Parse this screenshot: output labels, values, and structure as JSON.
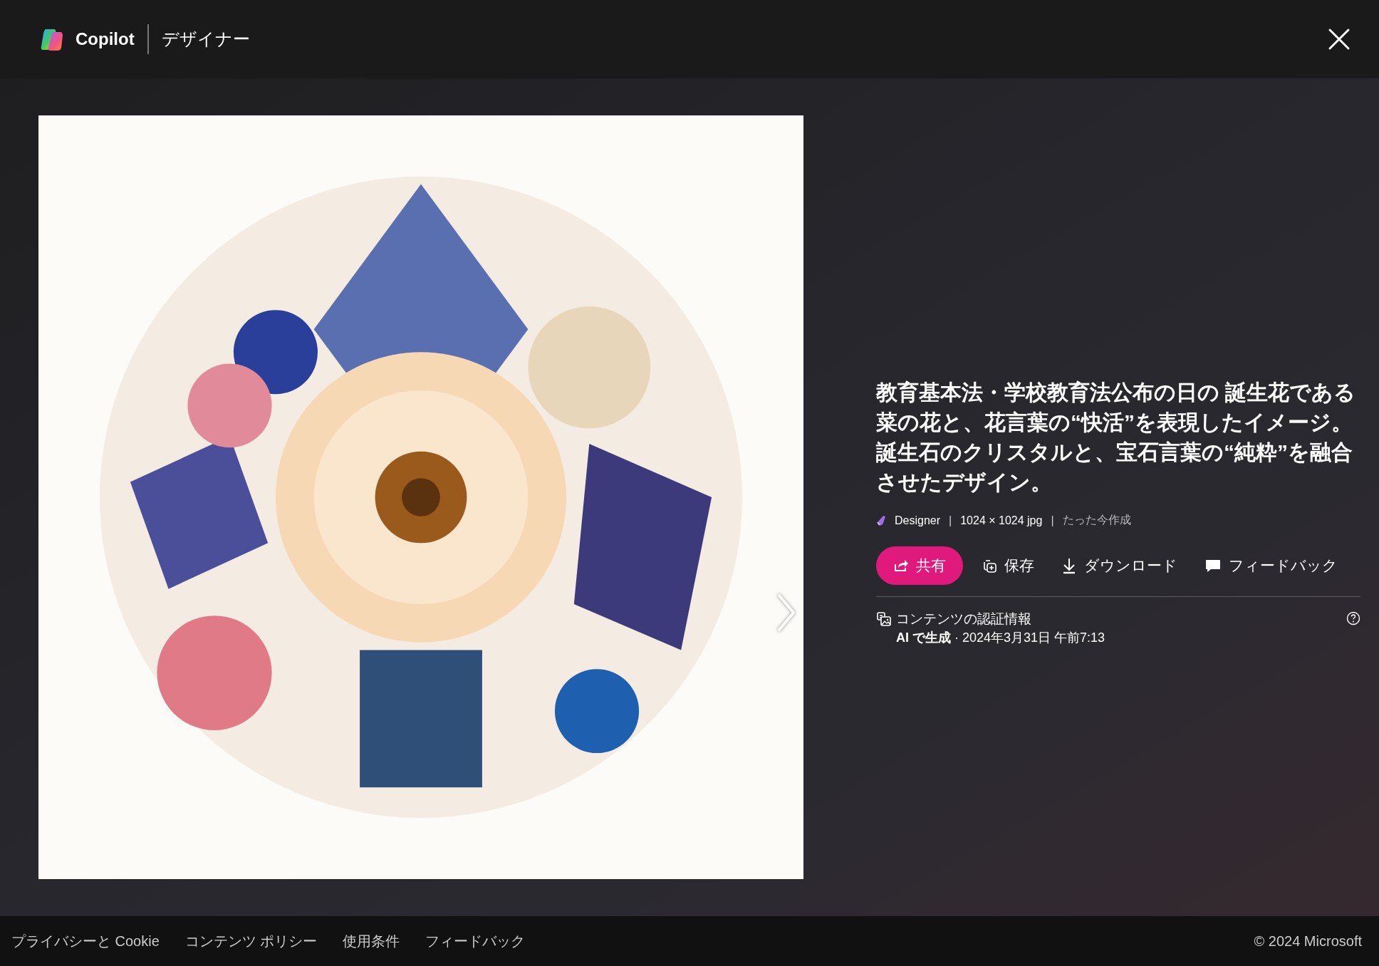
{
  "header": {
    "brand": "Copilot",
    "product": "デザイナー"
  },
  "details": {
    "title": "教育基本法・学校教育法公布の日の 誕生花である菜の花と、花言葉の“快活”を表現したイメージ。誕生石のクリスタルと、宝石言葉の“純粋”を融合させたデザイン。",
    "meta": [
      {
        "kind": "source",
        "text": "Designer"
      },
      {
        "kind": "sep",
        "text": "|"
      },
      {
        "kind": "plain",
        "text": "1024 × 1024 jpg"
      },
      {
        "kind": "sep",
        "text": "|"
      },
      {
        "kind": "muted",
        "text": "たった今作成"
      }
    ],
    "actions": [
      {
        "kind": "share",
        "label": "共有"
      },
      {
        "kind": "save",
        "label": "保存"
      },
      {
        "kind": "download",
        "label": "ダウンロード"
      },
      {
        "kind": "feedback",
        "label": "フィードバック"
      }
    ],
    "credentials": {
      "title": "コンテンツの認証情報",
      "detail": "**AI で生成** · 2024年3月31日 午前7:13"
    }
  },
  "footer": {
    "links": [
      "プライバシーと Cookie",
      "コンテンツ ポリシー",
      "使用条件",
      "フィードバック"
    ],
    "copyright": "© 2024 Microsoft"
  }
}
